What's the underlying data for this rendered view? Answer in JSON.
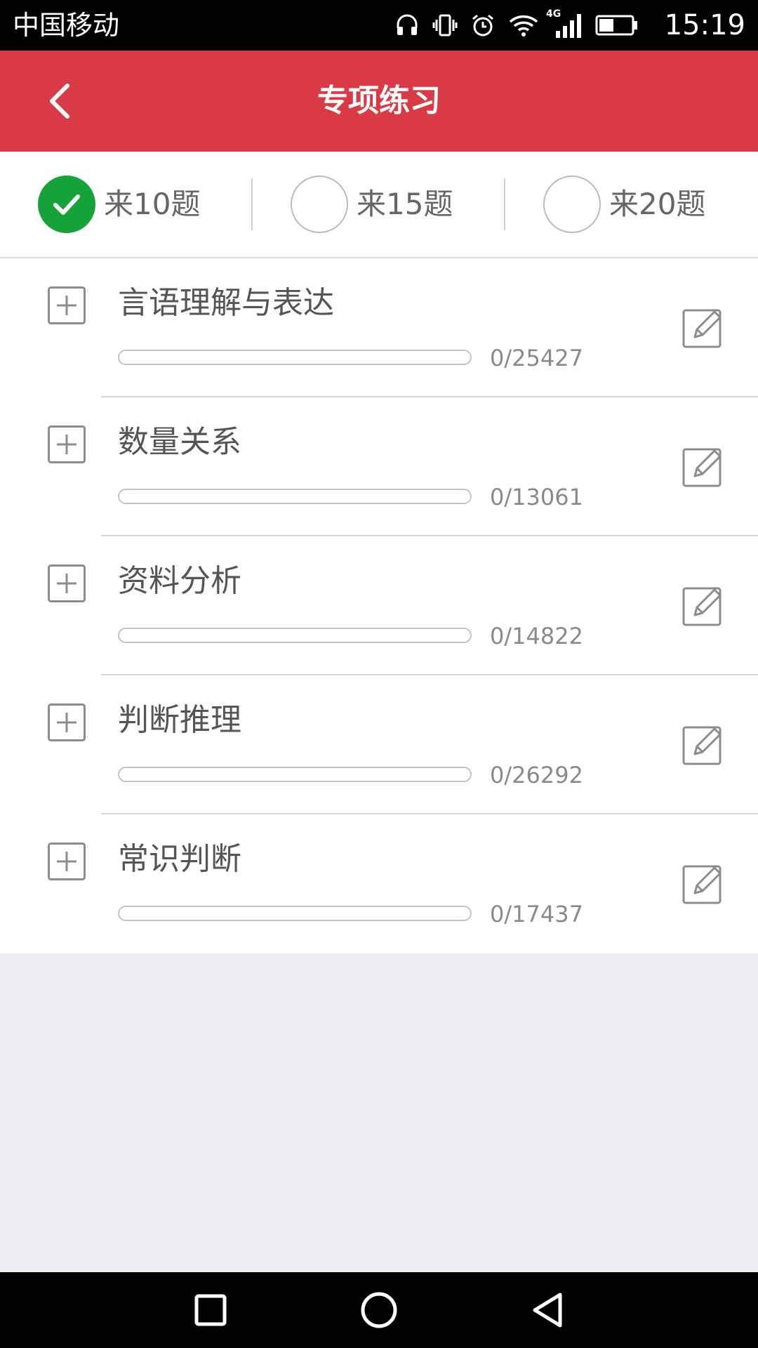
{
  "status_bar": {
    "carrier": "中国移动",
    "network": "4G",
    "time": "15:19",
    "icons": [
      "headphones-icon",
      "vibrate-icon",
      "alarm-icon",
      "wifi-icon",
      "signal-icon",
      "battery-icon"
    ]
  },
  "header": {
    "title": "专项练习",
    "back_icon": "chevron-left-icon"
  },
  "question_count_options": [
    {
      "label": "来10题",
      "selected": true
    },
    {
      "label": "来15题",
      "selected": false
    },
    {
      "label": "来20题",
      "selected": false
    }
  ],
  "categories": [
    {
      "name": "言语理解与表达",
      "progress": "0/25427",
      "done": 0,
      "total": 25427
    },
    {
      "name": "数量关系",
      "progress": "0/13061",
      "done": 0,
      "total": 13061
    },
    {
      "name": "资料分析",
      "progress": "0/14822",
      "done": 0,
      "total": 14822
    },
    {
      "name": "判断推理",
      "progress": "0/26292",
      "done": 0,
      "total": 26292
    },
    {
      "name": "常识判断",
      "progress": "0/17437",
      "done": 0,
      "total": 17437
    }
  ],
  "colors": {
    "header_bg": "#d93a45",
    "selected_green": "#16a43a",
    "page_bg": "#eeeef2"
  },
  "navigation": [
    "recents-square-icon",
    "home-circle-icon",
    "back-triangle-icon"
  ]
}
